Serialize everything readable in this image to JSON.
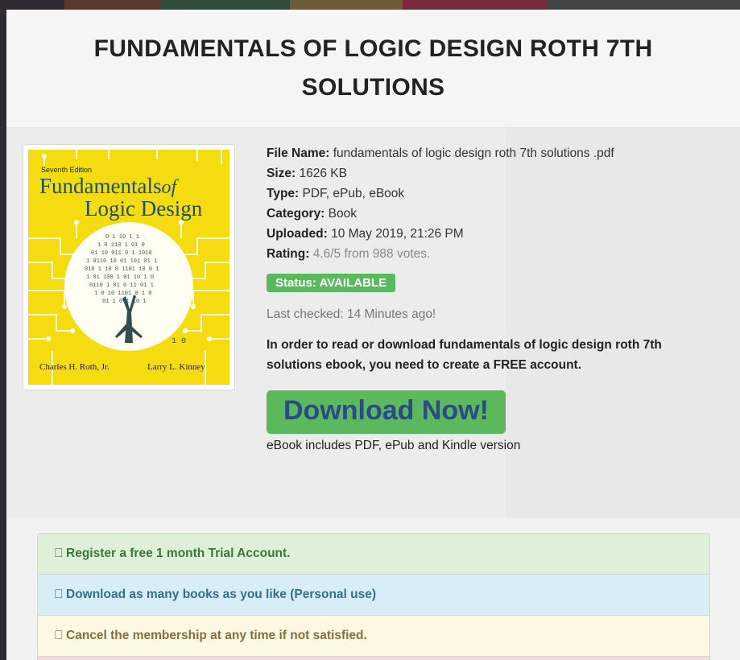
{
  "page": {
    "title": "FUNDAMENTALS OF LOGIC DESIGN ROTH 7TH SOLUTIONS"
  },
  "cover": {
    "edition": "Seventh Edition",
    "title_line1": "Fundamentals",
    "title_of": "of",
    "title_line2": "Logic Design",
    "author1": "Charles H. Roth, Jr.",
    "author2": "Larry L. Kinney"
  },
  "file": {
    "name_label": "File Name:",
    "name_value": "fundamentals of logic design roth 7th solutions .pdf",
    "size_label": "Size:",
    "size_value": "1626 KB",
    "type_label": "Type:",
    "type_value": "PDF, ePub, eBook",
    "category_label": "Category:",
    "category_value": "Book",
    "uploaded_label": "Uploaded:",
    "uploaded_value": "10 May 2019, 21:26 PM",
    "rating_label": "Rating:",
    "rating_value": "4.6/5 from 988 votes."
  },
  "status": "Status: AVAILABLE",
  "last_checked": "Last checked: 14 Minutes ago!",
  "notice": "In order to read or download fundamentals of logic design roth 7th solutions ebook, you need to create a FREE account.",
  "download_button": "Download Now!",
  "includes": "eBook includes PDF, ePub and Kindle version",
  "benefits": [
    {
      "icon": "",
      "icon_name": "check-icon",
      "text": "Register a free 1 month Trial Account."
    },
    {
      "icon": "",
      "icon_name": "check-icon",
      "text": "Download as many books as you like (Personal use)"
    },
    {
      "icon": "",
      "icon_name": "check-icon",
      "text": "Cancel the membership at any time if not satisfied."
    }
  ],
  "colors": {
    "status_green": "#5cb85c",
    "download_text": "#2b4a86",
    "cover_yellow": "#f5dc10"
  }
}
